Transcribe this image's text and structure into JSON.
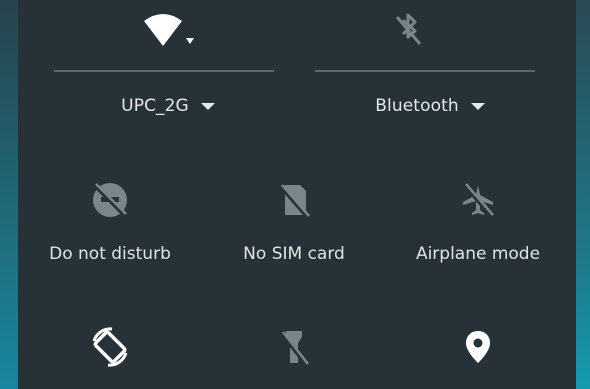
{
  "quick_settings": {
    "wifi": {
      "network_name": "UPC_2G",
      "icon": "wifi-icon",
      "state": "on"
    },
    "bluetooth": {
      "label": "Bluetooth",
      "icon": "bluetooth-off-icon",
      "state": "off"
    },
    "tiles_row1": [
      {
        "label": "Do not disturb",
        "icon": "do-not-disturb-off-icon"
      },
      {
        "label": "No SIM card",
        "icon": "no-sim-icon"
      },
      {
        "label": "Airplane mode",
        "icon": "airplane-icon"
      }
    ],
    "tiles_row2": [
      {
        "label": "",
        "icon": "auto-rotate-icon"
      },
      {
        "label": "",
        "icon": "flashlight-off-icon"
      },
      {
        "label": "",
        "icon": "location-icon"
      }
    ]
  },
  "colors": {
    "panel": "#263238",
    "active_icon": "#ffffff",
    "inactive_icon": "#79868b",
    "divider": "#5b6a70",
    "text": "#e6e8e9"
  }
}
